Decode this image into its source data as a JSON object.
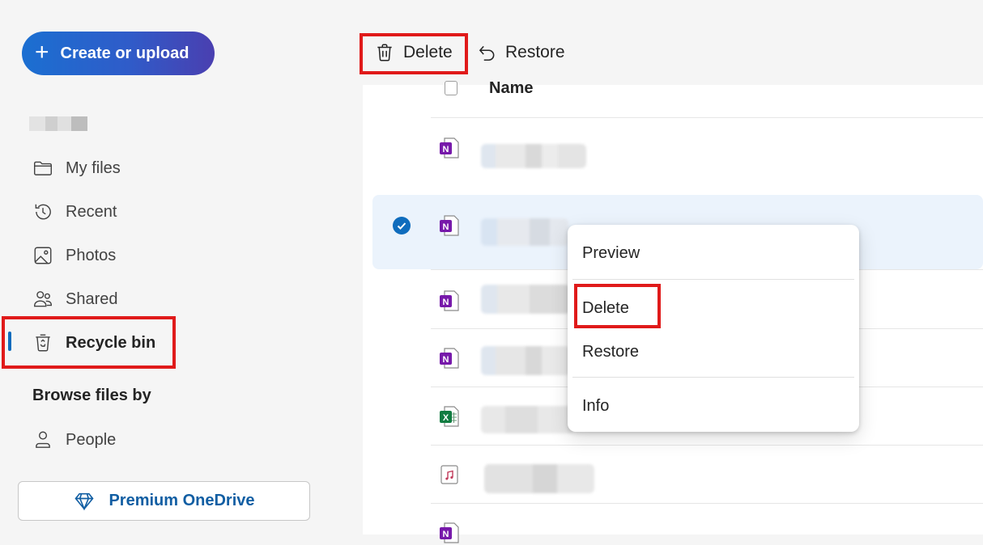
{
  "nav": {
    "create_label": "Create or upload",
    "items": [
      {
        "label": "My files",
        "icon": "folder-icon"
      },
      {
        "label": "Recent",
        "icon": "history-icon"
      },
      {
        "label": "Photos",
        "icon": "image-icon"
      },
      {
        "label": "Shared",
        "icon": "people-icon"
      },
      {
        "label": "Recycle bin",
        "icon": "recycle-bin-icon",
        "active": true
      }
    ],
    "browse_heading": "Browse files by",
    "browse_items": [
      {
        "label": "People",
        "icon": "person-icon"
      }
    ],
    "premium_label": "Premium OneDrive"
  },
  "toolbar": {
    "delete_label": "Delete",
    "restore_label": "Restore"
  },
  "list": {
    "column_name": "Name",
    "rows": [
      {
        "type": "onenote",
        "selected": false
      },
      {
        "type": "onenote",
        "selected": true
      },
      {
        "type": "onenote",
        "selected": false
      },
      {
        "type": "onenote",
        "selected": false
      },
      {
        "type": "excel",
        "selected": false
      },
      {
        "type": "audio",
        "selected": false
      },
      {
        "type": "onenote",
        "selected": false
      }
    ]
  },
  "context_menu": {
    "items": [
      "Preview",
      "Delete",
      "Restore",
      "Info"
    ]
  },
  "colors": {
    "accent": "#0f6cbd",
    "highlight": "#e01a1a",
    "onenote": "#7719aa",
    "excel": "#107c41"
  }
}
